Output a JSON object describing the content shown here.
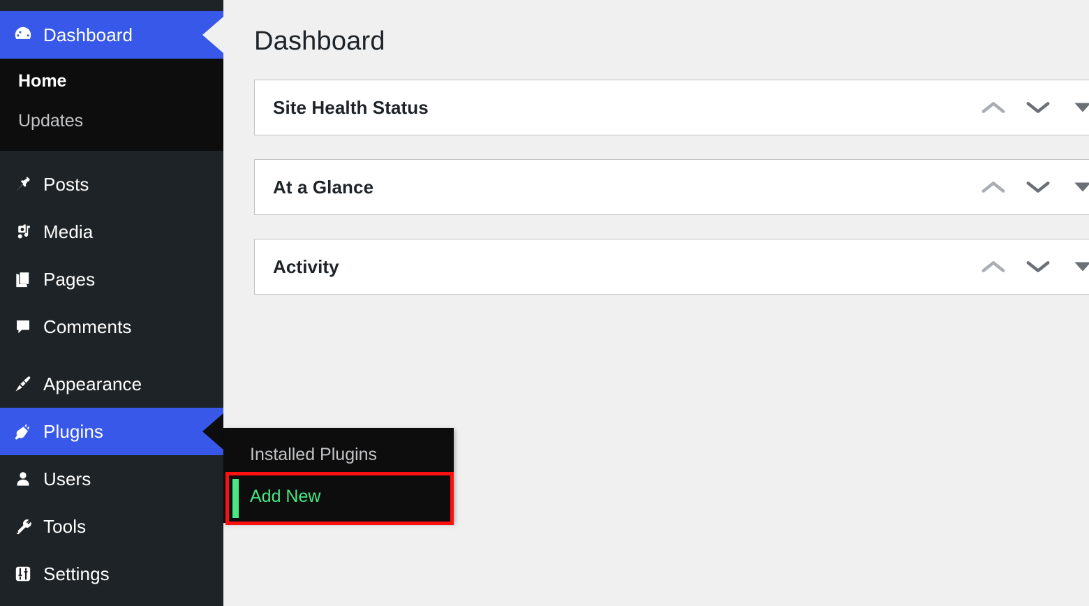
{
  "app": {
    "accent_blue": "#3858E9",
    "menu_bg": "#1D2327",
    "submenu_bg": "#0D0D0D",
    "content_bg": "#F0F0F1",
    "highlight_red": "#FF1010",
    "highlight_green": "#47E884"
  },
  "sidebar": {
    "dashboard": {
      "label": "Dashboard",
      "icon": "dashboard-icon",
      "current": true,
      "submenu": [
        {
          "label": "Home",
          "current": true
        },
        {
          "label": "Updates",
          "current": false
        }
      ]
    },
    "items": [
      {
        "label": "Posts",
        "icon": "pin-icon"
      },
      {
        "label": "Media",
        "icon": "media-icon"
      },
      {
        "label": "Pages",
        "icon": "pages-icon"
      },
      {
        "label": "Comments",
        "icon": "comment-icon"
      }
    ],
    "items2": [
      {
        "label": "Appearance",
        "icon": "paintbrush-icon"
      },
      {
        "label": "Plugins",
        "icon": "plugin-icon",
        "current": true
      },
      {
        "label": "Users",
        "icon": "user-icon"
      },
      {
        "label": "Tools",
        "icon": "wrench-icon"
      },
      {
        "label": "Settings",
        "icon": "settings-icon"
      }
    ]
  },
  "plugins_flyout": {
    "items": [
      {
        "label": "Installed Plugins",
        "highlight": false
      },
      {
        "label": "Add New",
        "highlight": true
      }
    ]
  },
  "main": {
    "page_title": "Dashboard",
    "widgets": [
      {
        "title": "Site Health Status"
      },
      {
        "title": "At a Glance"
      },
      {
        "title": "Activity"
      }
    ],
    "widget_controls": {
      "move_up": "chevron-up-icon",
      "move_down": "chevron-down-icon",
      "toggle": "triangle-down-icon"
    }
  }
}
